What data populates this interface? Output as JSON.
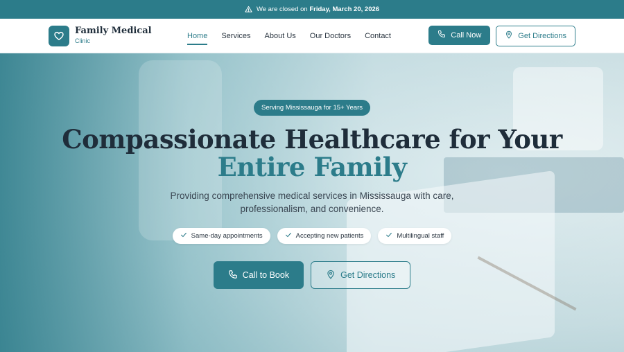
{
  "announcement": {
    "prefix": "We are closed on",
    "date": "Friday, March 20, 2026",
    "icon": "warning-triangle-icon"
  },
  "brand": {
    "name": "Family Medical",
    "subtitle": "Clinic",
    "logo_icon": "heart-icon"
  },
  "nav": {
    "items": [
      {
        "label": "Home",
        "active": true
      },
      {
        "label": "Services",
        "active": false
      },
      {
        "label": "About Us",
        "active": false
      },
      {
        "label": "Our Doctors",
        "active": false
      },
      {
        "label": "Contact",
        "active": false
      }
    ]
  },
  "header_actions": {
    "call_label": "Call Now",
    "directions_label": "Get Directions"
  },
  "hero": {
    "badge": "Serving Mississauga for 15+ Years",
    "title_line1": "Compassionate Healthcare for Your",
    "title_line2": "Entire Family",
    "subtitle_line1": "Providing comprehensive medical services in Mississauga with care,",
    "subtitle_line2": "professionalism, and convenience.",
    "features": [
      "Same-day appointments",
      "Accepting new patients",
      "Multilingual staff"
    ],
    "cta_call": "Call to Book",
    "cta_directions": "Get Directions"
  },
  "colors": {
    "brand": "#2c7c8a",
    "text_dark": "#1f2d3a",
    "white": "#ffffff"
  }
}
